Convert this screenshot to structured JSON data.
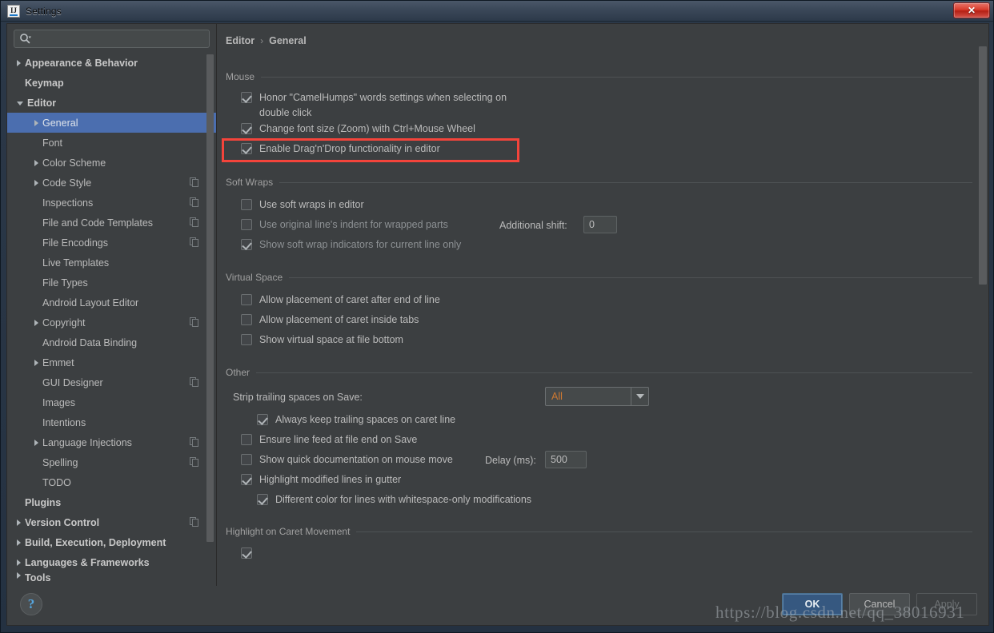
{
  "window": {
    "title": "Settings",
    "app_icon": "IJ",
    "close_label": "✕"
  },
  "colors": {
    "background": "#3c3f41",
    "selection": "#4b6eaf",
    "accent_orange": "#cc7832",
    "highlight_red": "#f4443b",
    "primary_button": "#365880"
  },
  "search": {
    "placeholder": "",
    "value": "",
    "icon": "search-icon"
  },
  "sidebar": {
    "items": [
      {
        "label": "Appearance & Behavior",
        "indent": 0,
        "arrow": "right",
        "bold": true,
        "selected": false,
        "copy": false
      },
      {
        "label": "Keymap",
        "indent": 0,
        "arrow": "none",
        "bold": true,
        "selected": false,
        "copy": false
      },
      {
        "label": "Editor",
        "indent": 0,
        "arrow": "down",
        "bold": true,
        "selected": false,
        "copy": false
      },
      {
        "label": "General",
        "indent": 1,
        "arrow": "right",
        "bold": false,
        "selected": true,
        "copy": false
      },
      {
        "label": "Font",
        "indent": 1,
        "arrow": "none",
        "bold": false,
        "selected": false,
        "copy": false
      },
      {
        "label": "Color Scheme",
        "indent": 1,
        "arrow": "right",
        "bold": false,
        "selected": false,
        "copy": false
      },
      {
        "label": "Code Style",
        "indent": 1,
        "arrow": "right",
        "bold": false,
        "selected": false,
        "copy": true
      },
      {
        "label": "Inspections",
        "indent": 1,
        "arrow": "none",
        "bold": false,
        "selected": false,
        "copy": true
      },
      {
        "label": "File and Code Templates",
        "indent": 1,
        "arrow": "none",
        "bold": false,
        "selected": false,
        "copy": true
      },
      {
        "label": "File Encodings",
        "indent": 1,
        "arrow": "none",
        "bold": false,
        "selected": false,
        "copy": true
      },
      {
        "label": "Live Templates",
        "indent": 1,
        "arrow": "none",
        "bold": false,
        "selected": false,
        "copy": false
      },
      {
        "label": "File Types",
        "indent": 1,
        "arrow": "none",
        "bold": false,
        "selected": false,
        "copy": false
      },
      {
        "label": "Android Layout Editor",
        "indent": 1,
        "arrow": "none",
        "bold": false,
        "selected": false,
        "copy": false
      },
      {
        "label": "Copyright",
        "indent": 1,
        "arrow": "right",
        "bold": false,
        "selected": false,
        "copy": true
      },
      {
        "label": "Android Data Binding",
        "indent": 1,
        "arrow": "none",
        "bold": false,
        "selected": false,
        "copy": false
      },
      {
        "label": "Emmet",
        "indent": 1,
        "arrow": "right",
        "bold": false,
        "selected": false,
        "copy": false
      },
      {
        "label": "GUI Designer",
        "indent": 1,
        "arrow": "none",
        "bold": false,
        "selected": false,
        "copy": true
      },
      {
        "label": "Images",
        "indent": 1,
        "arrow": "none",
        "bold": false,
        "selected": false,
        "copy": false
      },
      {
        "label": "Intentions",
        "indent": 1,
        "arrow": "none",
        "bold": false,
        "selected": false,
        "copy": false
      },
      {
        "label": "Language Injections",
        "indent": 1,
        "arrow": "right",
        "bold": false,
        "selected": false,
        "copy": true
      },
      {
        "label": "Spelling",
        "indent": 1,
        "arrow": "none",
        "bold": false,
        "selected": false,
        "copy": true
      },
      {
        "label": "TODO",
        "indent": 1,
        "arrow": "none",
        "bold": false,
        "selected": false,
        "copy": false
      },
      {
        "label": "Plugins",
        "indent": 0,
        "arrow": "none",
        "bold": true,
        "selected": false,
        "copy": false
      },
      {
        "label": "Version Control",
        "indent": 0,
        "arrow": "right",
        "bold": true,
        "selected": false,
        "copy": true
      },
      {
        "label": "Build, Execution, Deployment",
        "indent": 0,
        "arrow": "right",
        "bold": true,
        "selected": false,
        "copy": false
      },
      {
        "label": "Languages & Frameworks",
        "indent": 0,
        "arrow": "right",
        "bold": true,
        "selected": false,
        "copy": false
      },
      {
        "label": "Tools",
        "indent": 0,
        "arrow": "right",
        "bold": true,
        "selected": false,
        "copy": false,
        "clipped": true
      }
    ]
  },
  "breadcrumb": {
    "root": "Editor",
    "separator": "›",
    "leaf": "General"
  },
  "sections": {
    "mouse": {
      "title": "Mouse",
      "items": [
        {
          "label": "Honor \"CamelHumps\" words settings when selecting on double click",
          "checked": true,
          "enabled": true,
          "indent": 0
        },
        {
          "label": "Change font size (Zoom) with Ctrl+Mouse Wheel",
          "checked": true,
          "enabled": true,
          "indent": 0,
          "highlighted": true
        },
        {
          "label": "Enable Drag'n'Drop functionality in editor",
          "checked": true,
          "enabled": true,
          "indent": 0
        }
      ]
    },
    "soft_wraps": {
      "title": "Soft Wraps",
      "items": [
        {
          "label": "Use soft wraps in editor",
          "checked": false,
          "enabled": true,
          "indent": 0
        },
        {
          "label": "Use original line's indent for wrapped parts",
          "checked": false,
          "enabled": false,
          "indent": 0
        },
        {
          "label": "Show soft wrap indicators for current line only",
          "checked": true,
          "enabled": false,
          "indent": 0
        }
      ],
      "additional_shift_label": "Additional shift:",
      "additional_shift_value": "0"
    },
    "virtual_space": {
      "title": "Virtual Space",
      "items": [
        {
          "label": "Allow placement of caret after end of line",
          "checked": false,
          "enabled": true,
          "indent": 0
        },
        {
          "label": "Allow placement of caret inside tabs",
          "checked": false,
          "enabled": true,
          "indent": 0
        },
        {
          "label": "Show virtual space at file bottom",
          "checked": false,
          "enabled": true,
          "indent": 0
        }
      ]
    },
    "other": {
      "title": "Other",
      "strip_label": "Strip trailing spaces on Save:",
      "strip_value": "All",
      "items": [
        {
          "label": "Always keep trailing spaces on caret line",
          "checked": true,
          "enabled": true,
          "indent": 1
        },
        {
          "label": "Ensure line feed at file end on Save",
          "checked": false,
          "enabled": true,
          "indent": 0
        },
        {
          "label": "Show quick documentation on mouse move",
          "checked": false,
          "enabled": true,
          "indent": 0
        },
        {
          "label": "Highlight modified lines in gutter",
          "checked": true,
          "enabled": true,
          "indent": 0
        },
        {
          "label": "Different color for lines with whitespace-only modifications",
          "checked": true,
          "enabled": true,
          "indent": 1
        }
      ],
      "delay_label": "Delay (ms):",
      "delay_value": "500"
    },
    "highlight_caret": {
      "title": "Highlight on Caret Movement"
    }
  },
  "footer": {
    "help_label": "?",
    "ok_label": "OK",
    "cancel_label": "Cancel",
    "apply_label": "Apply"
  },
  "watermark": "https://blog.csdn.net/qq_38016931"
}
